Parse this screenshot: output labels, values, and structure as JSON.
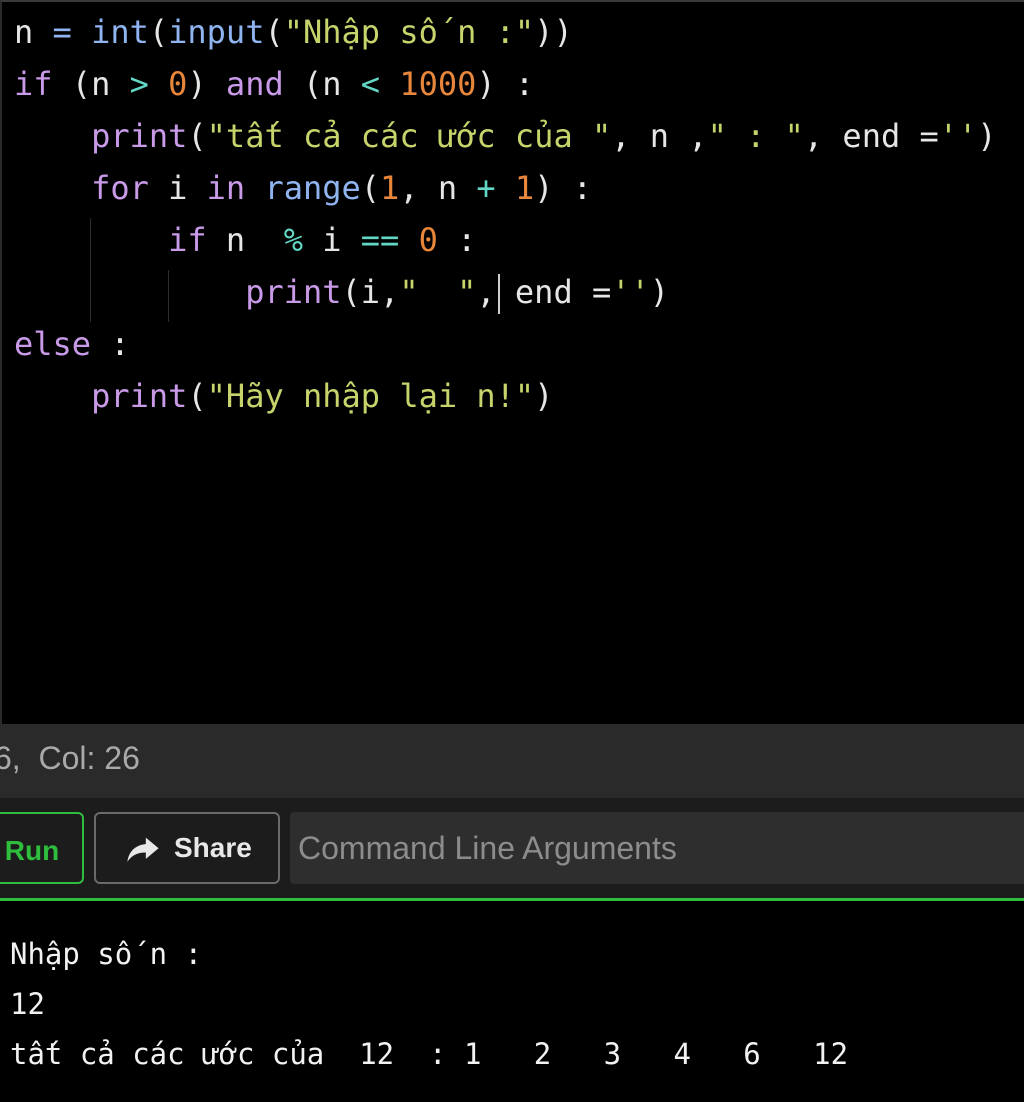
{
  "editor": {
    "lines": [
      [
        [
          "n ",
          "plain"
        ],
        [
          "=",
          "op"
        ],
        [
          " ",
          "plain"
        ],
        [
          "int",
          "kw-blue"
        ],
        [
          "(",
          "plain"
        ],
        [
          "input",
          "kw-blue"
        ],
        [
          "(",
          "plain"
        ],
        [
          "\"Nhập số n :\"",
          "str"
        ],
        [
          "))",
          "plain"
        ]
      ],
      [
        [
          "if",
          "kw-purple"
        ],
        [
          " (n ",
          "plain"
        ],
        [
          ">",
          "op2"
        ],
        [
          " ",
          "plain"
        ],
        [
          "0",
          "num"
        ],
        [
          ") ",
          "plain"
        ],
        [
          "and",
          "kw-purple"
        ],
        [
          " (n ",
          "plain"
        ],
        [
          "<",
          "op2"
        ],
        [
          " ",
          "plain"
        ],
        [
          "1000",
          "num"
        ],
        [
          ") :",
          "plain"
        ]
      ],
      [
        [
          "    ",
          "plain"
        ],
        [
          "print",
          "kw-purple"
        ],
        [
          "(",
          "plain"
        ],
        [
          "\"tất cả các ước của \"",
          "str"
        ],
        [
          ", n ,",
          "plain"
        ],
        [
          "\" : \"",
          "str"
        ],
        [
          ", end =",
          "plain"
        ],
        [
          "''",
          "str"
        ],
        [
          ")",
          "plain"
        ]
      ],
      [
        [
          "    ",
          "plain"
        ],
        [
          "for",
          "kw-purple"
        ],
        [
          " i ",
          "plain"
        ],
        [
          "in",
          "kw-purple"
        ],
        [
          " ",
          "plain"
        ],
        [
          "range",
          "kw-blue"
        ],
        [
          "(",
          "plain"
        ],
        [
          "1",
          "num"
        ],
        [
          ", n ",
          "plain"
        ],
        [
          "+",
          "op2"
        ],
        [
          " ",
          "plain"
        ],
        [
          "1",
          "num"
        ],
        [
          ") :",
          "plain"
        ]
      ],
      [
        [
          "        ",
          "plain"
        ],
        [
          "if",
          "kw-purple"
        ],
        [
          " n  ",
          "plain"
        ],
        [
          "%",
          "op2"
        ],
        [
          " i ",
          "plain"
        ],
        [
          "==",
          "op2"
        ],
        [
          " ",
          "plain"
        ],
        [
          "0",
          "num"
        ],
        [
          " :",
          "plain"
        ]
      ],
      [
        [
          "            ",
          "plain"
        ],
        [
          "print",
          "kw-purple"
        ],
        [
          "(i,",
          "plain"
        ],
        [
          "\"  \"",
          "str"
        ],
        [
          ", end =",
          "plain"
        ],
        [
          "''",
          "str"
        ],
        [
          ")",
          "plain"
        ]
      ],
      [
        [
          "else",
          "kw-purple"
        ],
        [
          " :",
          "plain"
        ]
      ],
      [
        [
          "    ",
          "plain"
        ],
        [
          "print",
          "kw-purple"
        ],
        [
          "(",
          "plain"
        ],
        [
          "\"Hãy nhập lại n!\"",
          "str"
        ],
        [
          ")",
          "plain"
        ]
      ]
    ]
  },
  "status": {
    "cursor_text": "6,  Col: 26"
  },
  "toolbar": {
    "run_label": "Run",
    "share_label": "Share",
    "share_icon": "share-arrow-icon",
    "args_placeholder": "Command Line Arguments"
  },
  "console": {
    "lines": [
      "Nhập số n :",
      "12",
      "tất cả các ước của  12  : 1   2   3   4   6   12"
    ]
  },
  "colors": {
    "accent_green": "#2ebd3c",
    "string": "#c7d36b",
    "number": "#e8873b",
    "keyword": "#c89ae8",
    "builtin": "#8fb4f0"
  }
}
